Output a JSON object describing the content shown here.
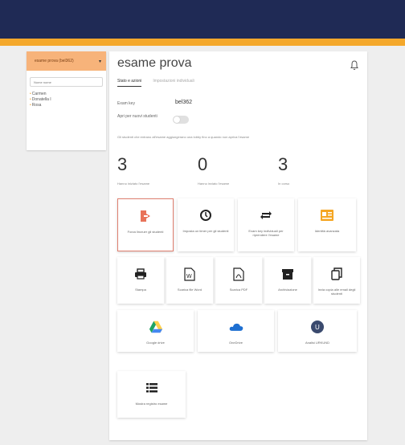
{
  "sidebar": {
    "exam_select": "esame prova (bel362)",
    "search_placeholder": "Nome nome",
    "students": [
      "Carmen",
      "Donatella I",
      "Rosa"
    ]
  },
  "main": {
    "title": "esame prova",
    "tabs": [
      {
        "label": "Stato e azioni",
        "active": true
      },
      {
        "label": "Impostazioni individuali",
        "active": false
      }
    ],
    "exam_key_label": "Exam key",
    "exam_key_value": "bel362",
    "open_for_new_label": "Apri per nuovi studenti",
    "open_for_new_value": false,
    "hint": "Gli studenti che entrano all'esame aggiungerano una lobby fino a quando non apriva l'esame",
    "stats": [
      {
        "value": "3",
        "label": "Hanno iniziato l'esame"
      },
      {
        "value": "0",
        "label": "Hanno inviato l'esame"
      },
      {
        "value": "3",
        "label": "In corso"
      }
    ],
    "actions": [
      {
        "label": "Forza lincruer gli studenti",
        "icon": "exit-door-icon"
      },
      {
        "label": "Imposta un timer per gli studenti",
        "icon": "timer-icon"
      },
      {
        "label": "Exam key individuali per riprendere l'esame",
        "icon": "key-swap-icon"
      },
      {
        "label": "Identità avanzata",
        "icon": "id-card-icon"
      },
      {
        "label": "Stampa",
        "icon": "print-icon"
      },
      {
        "label": "Scarica file Word",
        "icon": "word-file-icon"
      },
      {
        "label": "Scarica PDF",
        "icon": "pdf-file-icon"
      },
      {
        "label": "Archiviazione",
        "icon": "archive-icon"
      },
      {
        "label": "Invia copia alle email degli studenti",
        "icon": "copy-icon"
      },
      {
        "label": "Google drive",
        "icon": "google-drive-icon"
      },
      {
        "label": "OneDrive",
        "icon": "onedrive-icon"
      },
      {
        "label": "Analisi URKUND",
        "icon": "urkund-icon"
      },
      {
        "label": "Mostra registro esame",
        "icon": "list-icon"
      }
    ]
  },
  "colors": {
    "header": "#1f2a55",
    "accent": "#f4a82b",
    "exam_select_bg": "#f7b37a",
    "exit_icon": "#e8735a",
    "id_card_icon": "#f5a623",
    "drive_green": "#1fa463",
    "drive_yellow": "#ffd04b",
    "drive_blue": "#4688f1",
    "onedrive_blue": "#1e6fd1"
  }
}
